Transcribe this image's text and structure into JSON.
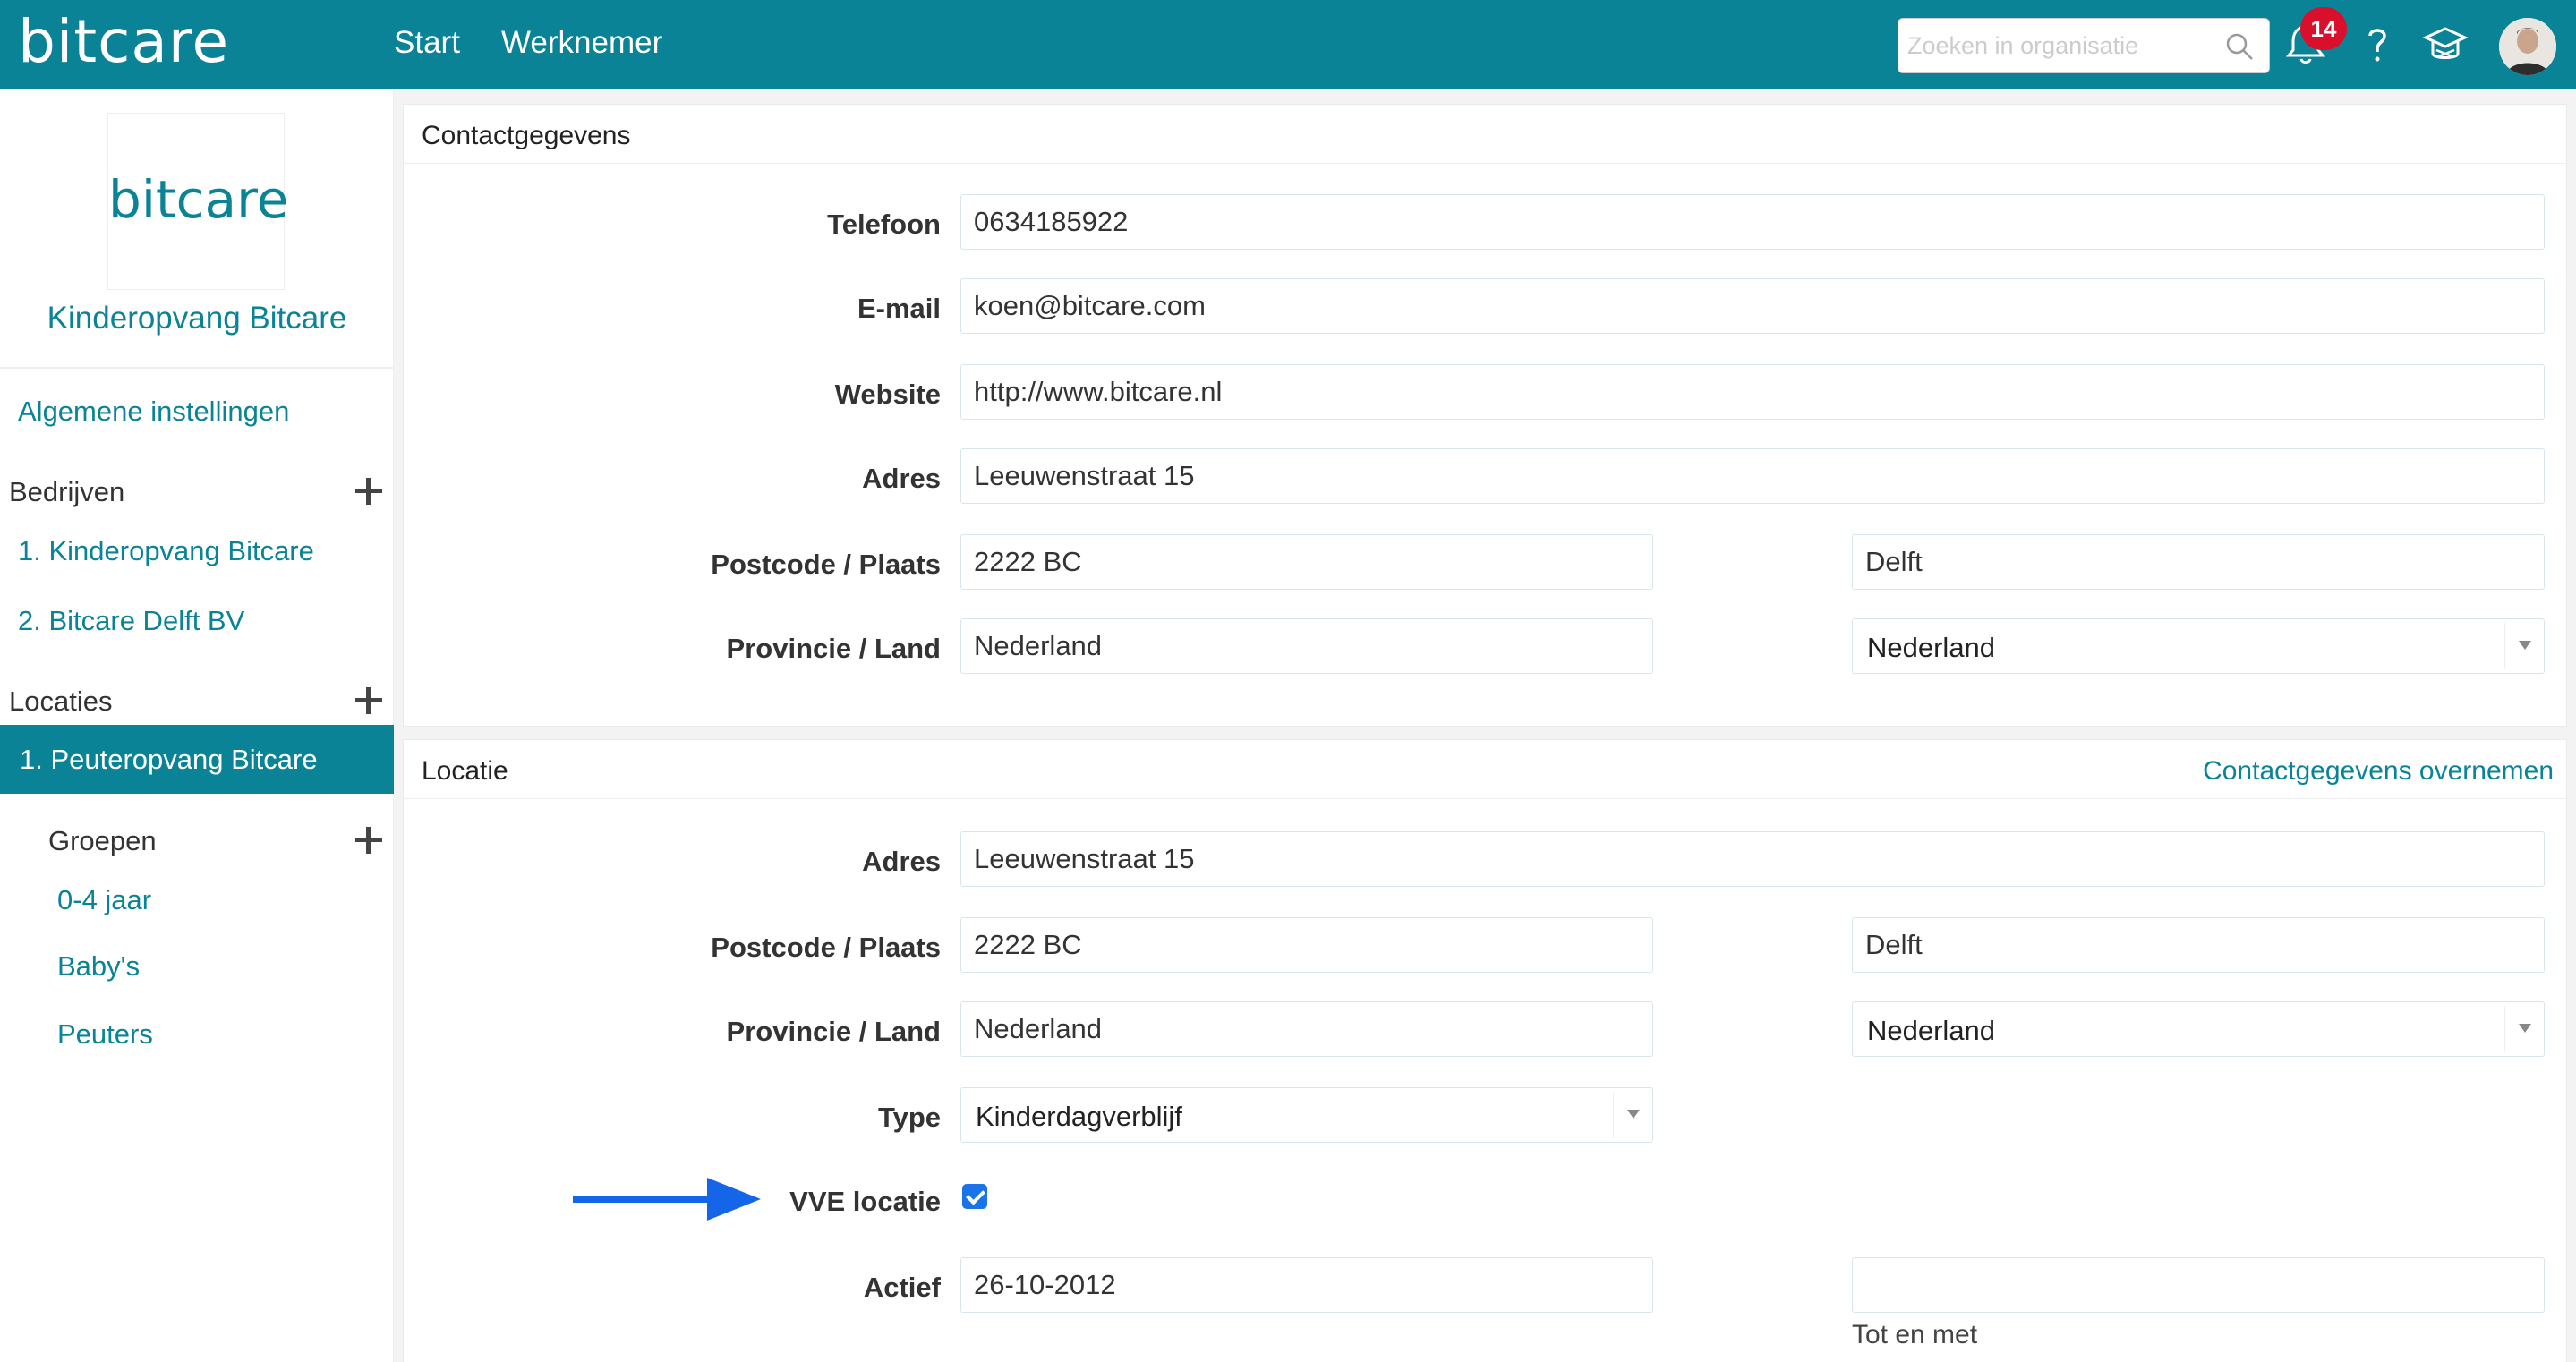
{
  "app": {
    "logo": "bitcare",
    "nav": [
      "Start",
      "Werknemer"
    ],
    "search_placeholder": "Zoeken in organisatie",
    "notification_count": "14",
    "accent": "#0a8397",
    "icons": [
      "search-icon",
      "bell-icon",
      "help-icon",
      "graduation-cap-icon"
    ]
  },
  "sidebar": {
    "org_logo": "bitcare",
    "org_name": "Kinderopvang Bitcare",
    "general_settings": "Algemene instellingen",
    "companies_heading": "Bedrijven",
    "companies": [
      "1. Kinderopvang Bitcare",
      "2. Bitcare Delft BV"
    ],
    "locations_heading": "Locaties",
    "active_location": "1. Peuteropvang Bitcare",
    "groups_heading": "Groepen",
    "groups": [
      "0-4 jaar",
      "Baby's",
      "Peuters"
    ]
  },
  "contact": {
    "title": "Contactgegevens",
    "labels": {
      "phone": "Telefoon",
      "email": "E-mail",
      "website": "Website",
      "address": "Adres",
      "postcode_city": "Postcode / Plaats",
      "province_country": "Provincie / Land"
    },
    "values": {
      "phone": "0634185922",
      "email": "koen@bitcare.com",
      "website": "http://www.bitcare.nl",
      "address": "Leeuwenstraat 15",
      "postcode": "2222 BC",
      "city": "Delft",
      "province": "Nederland",
      "country": "Nederland"
    }
  },
  "location": {
    "title": "Locatie",
    "action": "Contactgegevens overnemen",
    "labels": {
      "address": "Adres",
      "postcode_city": "Postcode / Plaats",
      "province_country": "Provincie / Land",
      "type": "Type",
      "vve": "VVE locatie",
      "active": "Actief"
    },
    "values": {
      "address": "Leeuwenstraat 15",
      "postcode": "2222 BC",
      "city": "Delft",
      "province": "Nederland",
      "country": "Nederland",
      "type": "Kinderdagverblijf",
      "vve_checked": true,
      "active_from": "26-10-2012",
      "active_to": ""
    },
    "helper_until": "Tot en met"
  }
}
